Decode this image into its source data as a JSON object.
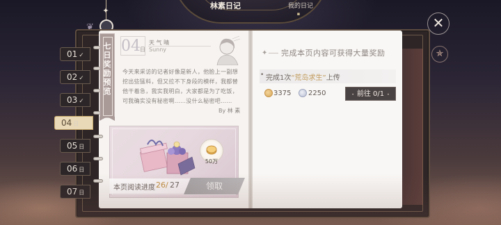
{
  "top_nav": {
    "active_tab": "林素日记",
    "other_tab": "我的日记"
  },
  "side_tabs": [
    {
      "num": "01",
      "suffix": "✓",
      "state": "done"
    },
    {
      "num": "02",
      "suffix": "✓",
      "state": "done"
    },
    {
      "num": "03",
      "suffix": "✓",
      "state": "done"
    },
    {
      "num": "04",
      "suffix": "日",
      "state": "active"
    },
    {
      "num": "05",
      "suffix": "日",
      "state": "locked"
    },
    {
      "num": "06",
      "suffix": "日",
      "state": "locked"
    },
    {
      "num": "07",
      "suffix": "日",
      "state": "locked"
    }
  ],
  "bookmark": {
    "label": "七日奖励预览"
  },
  "diary": {
    "date_num": "04",
    "date_day": "日",
    "weather_cn": "天 气 晴",
    "weather_en": "Sunny",
    "text": "今天来采访的记者好像是新人，他脸上一副想挖出些猛料，但又拉不下身段的模样，我都替他干着急，我实我明白，大家都是为了吃饭，可我确实没有秘密啊……没什么秘密吧……",
    "author": "By 林 素"
  },
  "reward": {
    "coin_amount": "50万",
    "progress_label": "本页阅读进度",
    "progress_current": "26/",
    "progress_total": "27",
    "claim_label": "领取"
  },
  "task_panel": {
    "header": "完成本页内容可获得大量奖励",
    "task_bullet": "•",
    "task_prefix": "完成1次",
    "task_highlight": "“荒岛求生”",
    "task_suffix": "上传",
    "task_frac": "",
    "reward_gold": "3375",
    "reward_silver": "2250",
    "go_label": "前往 0/1"
  },
  "icons": {
    "close": "close-icon",
    "lock": "lock-icon",
    "star": "star-icon"
  },
  "colors": {
    "accent_gold": "#c19a5b",
    "page_bg": "#f6f3f0",
    "frame": "#2d2526"
  }
}
